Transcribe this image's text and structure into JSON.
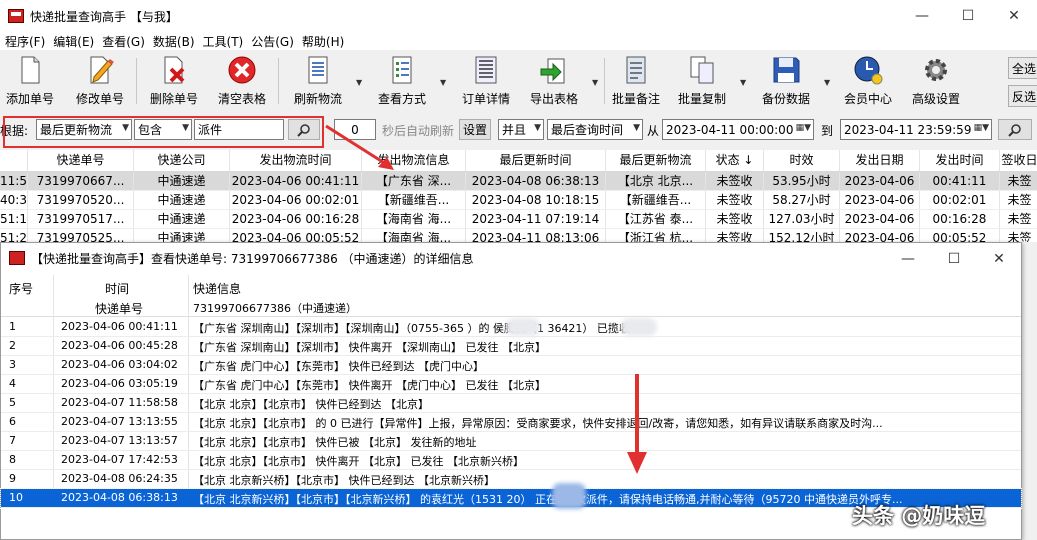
{
  "window": {
    "title": "快递批量查询高手 【与我】",
    "min": "—",
    "max": "☐",
    "close": "✕"
  },
  "menu": [
    "程序(F)",
    "编辑(E)",
    "查看(G)",
    "数据(B)",
    "工具(T)",
    "公告(G)",
    "帮助(H)"
  ],
  "toolbar": [
    {
      "label": "添加单号",
      "icon": "add-page-icon"
    },
    {
      "label": "修改单号",
      "icon": "edit-pencil-icon"
    },
    {
      "label": "删除单号",
      "icon": "delete-page-icon"
    },
    {
      "label": "清空表格",
      "icon": "clear-red-x-icon"
    },
    {
      "label": "刷新物流",
      "icon": "refresh-list-icon"
    },
    {
      "label": "查看方式",
      "icon": "view-list-icon"
    },
    {
      "label": "订单详情",
      "icon": "order-detail-icon"
    },
    {
      "label": "导出表格",
      "icon": "export-icon"
    },
    {
      "label": "批量备注",
      "icon": "note-icon"
    },
    {
      "label": "批量复制",
      "icon": "copy-icon"
    },
    {
      "label": "备份数据",
      "icon": "save-icon"
    },
    {
      "label": "会员中心",
      "icon": "clock-globe-icon"
    },
    {
      "label": "高级设置",
      "icon": "gear-icon"
    }
  ],
  "side_buttons": [
    "全选",
    "反选"
  ],
  "filter": {
    "label": "根据:",
    "field": "最后更新物流",
    "op": "包含",
    "keyword": "派件",
    "interval": "0",
    "interval_suffix": "秒后自动刷新",
    "settings": "设置",
    "and": "并且",
    "time_field": "最后查询时间",
    "from_label": "从",
    "from": "2023-04-11 00:00:00",
    "to_label": "到",
    "to": "2023-04-11 23:59:59"
  },
  "grid": {
    "columns": [
      "快递单号",
      "快递公司",
      "发出物流时间",
      "发出物流信息",
      "最后更新时间",
      "最后更新物流",
      "状态 ↓",
      "时效",
      "发出日期",
      "发出时间",
      "签收日"
    ],
    "rows": [
      [
        "11:54",
        "7319970667...",
        "中通速递",
        "2023-04-06 00:41:11",
        "【广东省 深...",
        "2023-04-08 06:38:13",
        "【北京 北京...",
        "未签收",
        "53.95小时",
        "2023-04-06",
        "00:41:11",
        "未签"
      ],
      [
        "40:32",
        "7319970520...",
        "中通速递",
        "2023-04-06 00:02:01",
        "【新疆维吾...",
        "2023-04-08 10:18:15",
        "【新疆维吾...",
        "未签收",
        "58.27小时",
        "2023-04-06",
        "00:02:01",
        "未签"
      ],
      [
        "51:13",
        "7319970517...",
        "中通速递",
        "2023-04-06 00:16:28",
        "【海南省 海...",
        "2023-04-11 07:19:14",
        "【江苏省 泰...",
        "未签收",
        "127.03小时",
        "2023-04-06",
        "00:16:28",
        "未签"
      ],
      [
        "51:23",
        "7319970525...",
        "中通速递",
        "2023-04-06 00:05:52",
        "【海南省 海...",
        "2023-04-11 08:13:06",
        "【浙江省 杭...",
        "未签收",
        "152.12小时",
        "2023-04-06",
        "00:05:52",
        "未签"
      ]
    ]
  },
  "detail": {
    "title": "【快递批量查询高手】查看快递单号: 73199706677386 （中通速递）的详细信息",
    "headers": {
      "seq": "序号",
      "time": "时间",
      "info": "快递信息",
      "sub_time": "快递单号",
      "sub_info": "73199706677386（中通速递）"
    },
    "rows": [
      {
        "n": "1",
        "t": "2023-04-06 00:41:11",
        "i": "【广东省 深圳南山】【深圳市】【深圳南山】（0755-365      ）的 侯腾腾（1      36421） 已揽收"
      },
      {
        "n": "2",
        "t": "2023-04-06 00:45:28",
        "i": "【广东省 深圳南山】【深圳市】 快件离开 【深圳南山】 已发往 【北京】"
      },
      {
        "n": "3",
        "t": "2023-04-06 03:04:02",
        "i": "【广东省 虎门中心】【东莞市】 快件已经到达 【虎门中心】"
      },
      {
        "n": "4",
        "t": "2023-04-06 03:05:19",
        "i": "【广东省 虎门中心】【东莞市】 快件离开 【虎门中心】 已发往 【北京】"
      },
      {
        "n": "5",
        "t": "2023-04-07 11:58:58",
        "i": "【北京 北京】【北京市】 快件已经到达 【北京】"
      },
      {
        "n": "6",
        "t": "2023-04-07 13:13:55",
        "i": "【北京 北京】【北京市】 的 0 已进行【异常件】上报，异常原因：受商家要求，快件安排退回/改寄，请您知悉，如有异议请联系商家及时沟..."
      },
      {
        "n": "7",
        "t": "2023-04-07 13:13:57",
        "i": "【北京 北京】【北京市】 快件已被 【北京】 发往新的地址"
      },
      {
        "n": "8",
        "t": "2023-04-07 17:42:53",
        "i": "【北京 北京】【北京市】 快件离开 【北京】 已发往 【北京新兴桥】"
      },
      {
        "n": "9",
        "t": "2023-04-08 06:24:35",
        "i": "【北京 北京新兴桥】【北京市】 快件已经到达 【北京新兴桥】"
      },
      {
        "n": "10",
        "t": "2023-04-08 06:38:13",
        "i": "【北京 北京新兴桥】【北京市】【北京新兴桥】 的袁红光（1531      20） 正在第2次派件，请保持电话畅通,并耐心等待（95720 中通快递员外呼专..."
      }
    ]
  },
  "watermark": "头条 @奶味逗"
}
